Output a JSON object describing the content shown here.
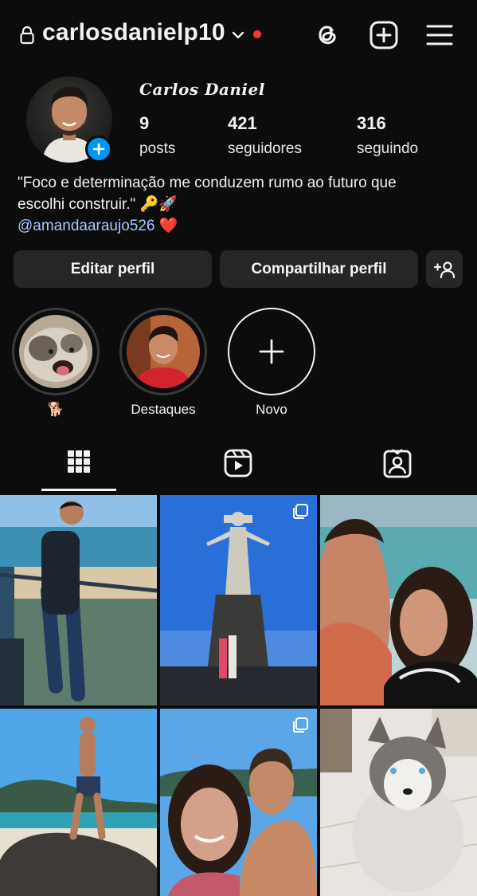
{
  "header": {
    "username": "carlosdanielp10",
    "has_notification_dot": true,
    "icons": [
      "lock-icon",
      "chevron-down-icon",
      "threads-icon",
      "create-icon",
      "menu-icon"
    ]
  },
  "profile": {
    "full_name": "Carlos Daniel",
    "stats": [
      {
        "value": "9",
        "label": "posts"
      },
      {
        "value": "421",
        "label": "seguidores"
      },
      {
        "value": "316",
        "label": "seguindo"
      }
    ],
    "bio_line1": "\"Foco e determinação me conduzem rumo ao futuro que",
    "bio_line2": "escolhi construir.\" 🔑🚀",
    "mention": "@amandaaraujo526",
    "heart": "❤️"
  },
  "actions": {
    "edit_label": "Editar perfil",
    "share_label": "Compartilhar perfil"
  },
  "highlights": [
    {
      "label": "🐕"
    },
    {
      "label": "Destaques"
    },
    {
      "label": "Novo"
    }
  ],
  "tabs": {
    "active": "grid",
    "items": [
      "grid-icon",
      "reels-icon",
      "tagged-icon"
    ]
  },
  "colors": {
    "background": "#0c0c0c",
    "button": "#262626",
    "mention": "#a6c8ff",
    "accent_blue": "#0095f6",
    "notification_red": "#ff3040"
  }
}
